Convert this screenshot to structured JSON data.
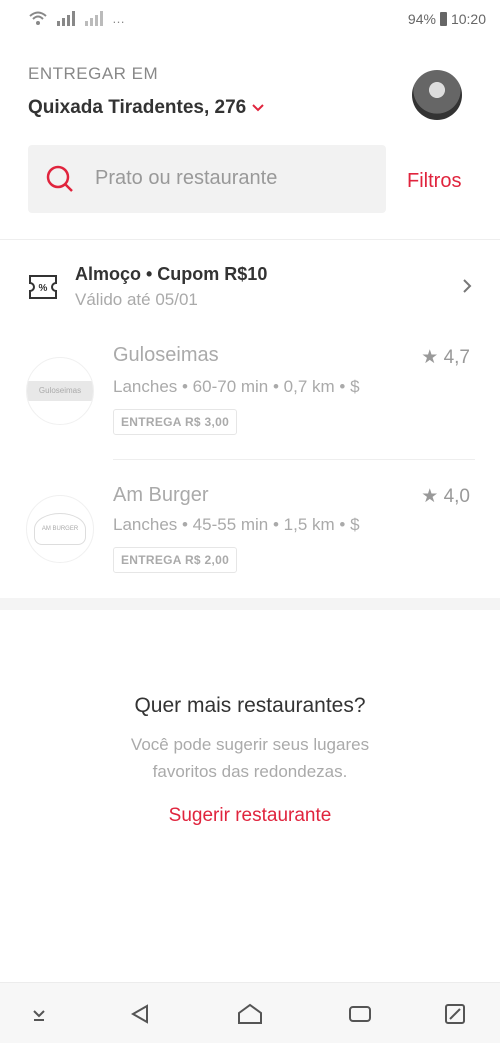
{
  "status_bar": {
    "notifications": "…",
    "battery": "94%",
    "time": "10:20"
  },
  "header": {
    "deliver_label": "ENTREGAR EM",
    "address": "Quixada Tiradentes, 276"
  },
  "search": {
    "placeholder": "Prato ou restaurante",
    "filters_label": "Filtros"
  },
  "coupon": {
    "title": "Almoço • Cupom R$10",
    "subtitle": "Válido até 05/01"
  },
  "restaurants": [
    {
      "name": "Guloseimas",
      "rating": "★ 4,7",
      "meta": "Lanches • 60-70 min  • 0,7 km • $",
      "delivery": "ENTREGA R$ 3,00",
      "logo_text": "Guloseimas"
    },
    {
      "name": "Am Burger",
      "rating": "★ 4,0",
      "meta": "Lanches • 45-55 min  • 1,5 km • $",
      "delivery": "ENTREGA R$ 2,00",
      "logo_text": "AM BURGER"
    }
  ],
  "more": {
    "title": "Quer mais restaurantes?",
    "description_line1": "Você pode sugerir seus lugares",
    "description_line2": "favoritos das redondezas.",
    "suggest_label": "Sugerir restaurante"
  },
  "colors": {
    "accent": "#e0243d",
    "muted": "#aaaaaa",
    "text": "#333333"
  },
  "icons": [
    "wifi-icon",
    "signal-icon",
    "battery-icon",
    "chevron-down-icon",
    "search-icon",
    "coupon-icon",
    "chevron-right-icon",
    "down-arrow-icon",
    "back-icon",
    "home-icon",
    "recents-icon",
    "expand-icon"
  ]
}
